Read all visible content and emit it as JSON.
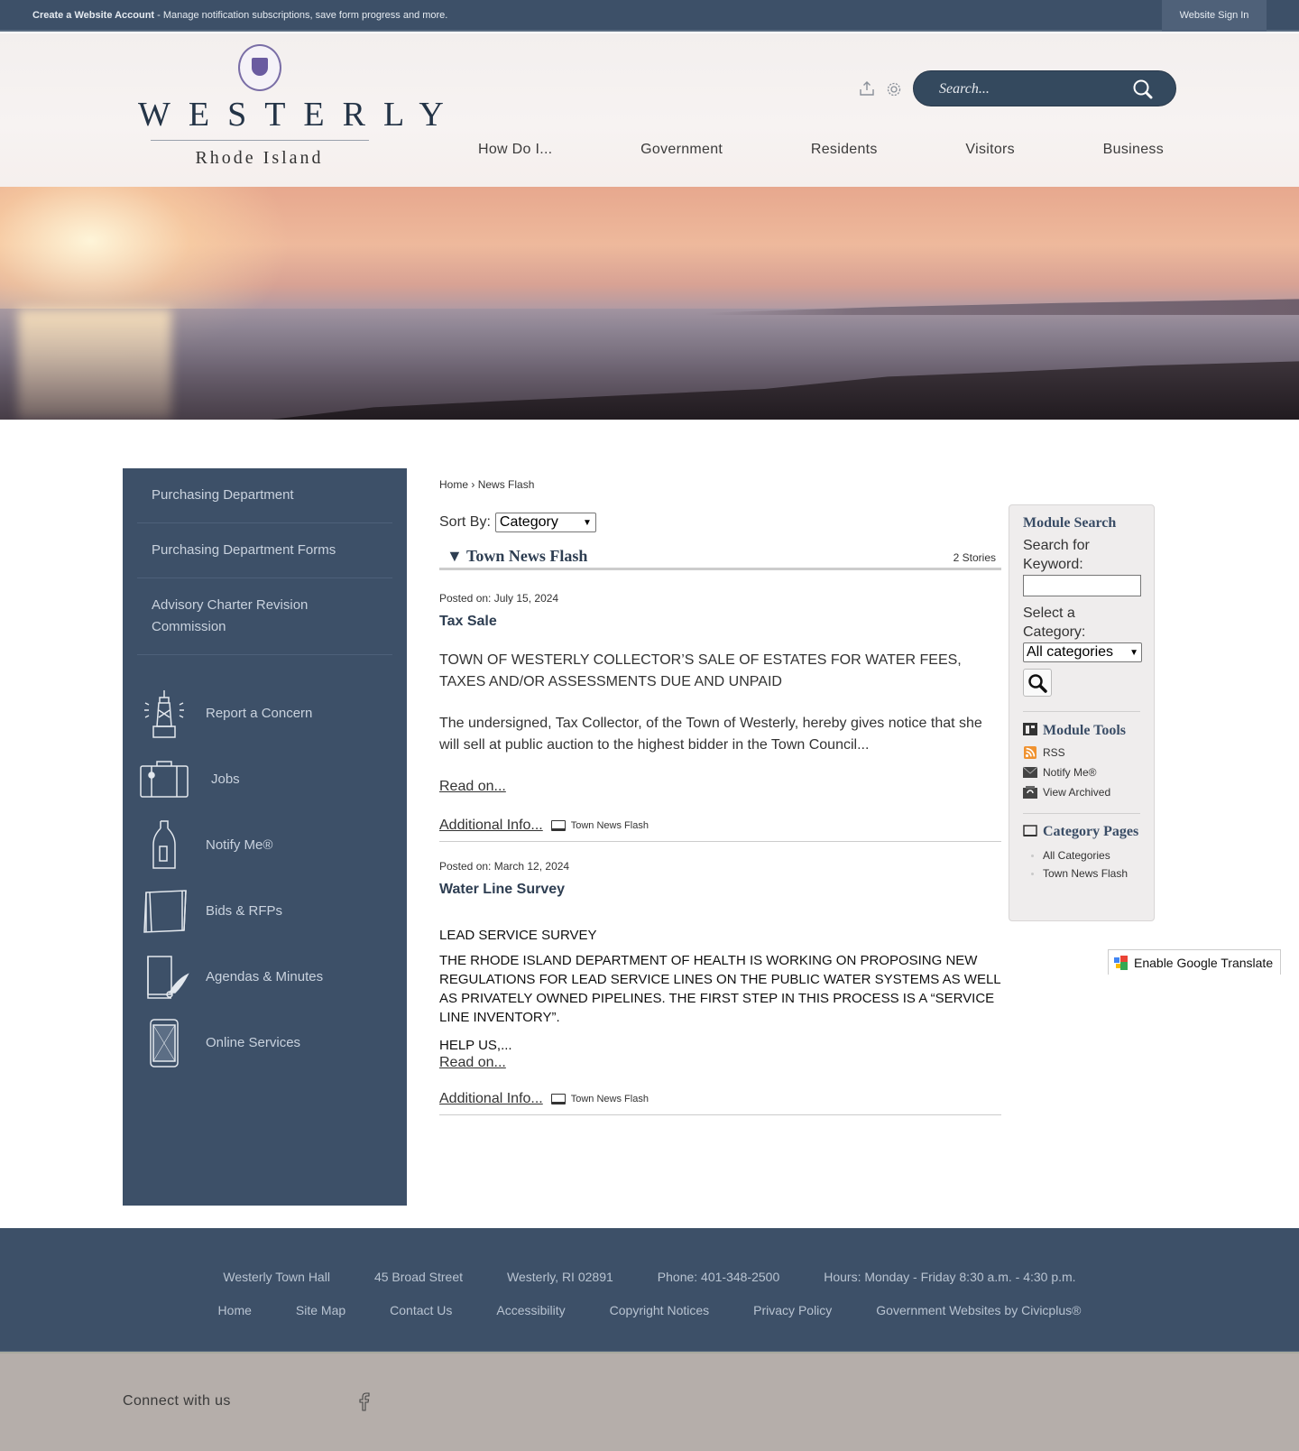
{
  "topbar": {
    "account_link": "Create a Website Account",
    "account_msg": " - Manage notification subscriptions, save form progress and more.",
    "signin": "Website Sign In"
  },
  "logo": {
    "word": "WESTERLY",
    "sub": "Rhode Island"
  },
  "header": {
    "search_placeholder": "Search...",
    "icons": [
      "share-icon",
      "settings-gear-icon",
      "search-icon"
    ]
  },
  "nav": [
    "How Do I...",
    "Government",
    "Residents",
    "Visitors",
    "Business"
  ],
  "sidebar": {
    "links": [
      "Purchasing Department",
      "Purchasing Department Forms",
      "Advisory Charter Revision Commission"
    ],
    "quick_links": [
      {
        "label": "Report a Concern",
        "icon": "lighthouse-icon"
      },
      {
        "label": "Jobs",
        "icon": "suitcase-icon"
      },
      {
        "label": "Notify Me®",
        "icon": "bottle-message-icon"
      },
      {
        "label": "Bids & RFPs",
        "icon": "scroll-icon"
      },
      {
        "label": "Agendas & Minutes",
        "icon": "quill-document-icon"
      },
      {
        "label": "Online Services",
        "icon": "smartphone-icon"
      }
    ]
  },
  "breadcrumb": {
    "home": "Home",
    "sep": " › ",
    "current": "News Flash"
  },
  "sort": {
    "label": "Sort By:",
    "value": "Category"
  },
  "category": {
    "title": "Town News Flash",
    "toggle": "▼",
    "count": "2 Stories"
  },
  "stories": [
    {
      "posted": "Posted on: July 15, 2024",
      "title": "Tax Sale",
      "paragraphs": [
        "TOWN OF WESTERLY COLLECTOR’S SALE OF ESTATES FOR WATER FEES, TAXES AND/OR ASSESSMENTS DUE AND UNPAID",
        "The undersigned, Tax Collector, of the Town of Westerly, hereby gives notice that she will sell at public auction to the highest bidder in the Town Council..."
      ],
      "read_on": "Read on...",
      "additional": "Additional Info...",
      "category": "Town News Flash"
    },
    {
      "posted": "Posted on: March 12, 2024",
      "title": "Water Line Survey",
      "paragraphs": [
        "LEAD SERVICE SURVEY",
        "THE RHODE ISLAND DEPARTMENT OF HEALTH IS WORKING ON PROPOSING NEW REGULATIONS FOR LEAD SERVICE LINES ON THE PUBLIC WATER SYSTEMS AS WELL AS PRIVATELY OWNED PIPELINES. THE FIRST STEP IN THIS PROCESS IS A “SERVICE LINE INVENTORY”.",
        "HELP US,..."
      ],
      "read_on": "Read on...",
      "additional": "Additional Info...",
      "category": "Town News Flash"
    }
  ],
  "module_search": {
    "title": "Module Search",
    "keyword_label": "Search for Keyword:",
    "keyword_value": "",
    "category_label": "Select a Category:",
    "category_value": "All categories",
    "tools_title": "Module Tools",
    "tools": [
      "RSS",
      "Notify Me®",
      "View Archived"
    ],
    "pages_title": "Category Pages",
    "pages": [
      "All Categories",
      "Town News Flash"
    ]
  },
  "translate": "Enable Google Translate",
  "footer": {
    "info": [
      "Westerly Town Hall",
      "45 Broad Street",
      "Westerly, RI 02891",
      "Phone: 401-348-2500",
      "Hours: Monday - Friday 8:30 a.m. - 4:30 p.m."
    ],
    "links": [
      "Home",
      "Site Map",
      "Contact Us",
      "Accessibility",
      "Copyright Notices",
      "Privacy Policy",
      "Government Websites by Civicplus®"
    ]
  },
  "connect": {
    "label": "Connect with us",
    "icon": "facebook-icon"
  },
  "colors": {
    "navy": "#3d5068",
    "accent_text": "#2e3e52",
    "footer_bottom": "#b5aeaa"
  }
}
